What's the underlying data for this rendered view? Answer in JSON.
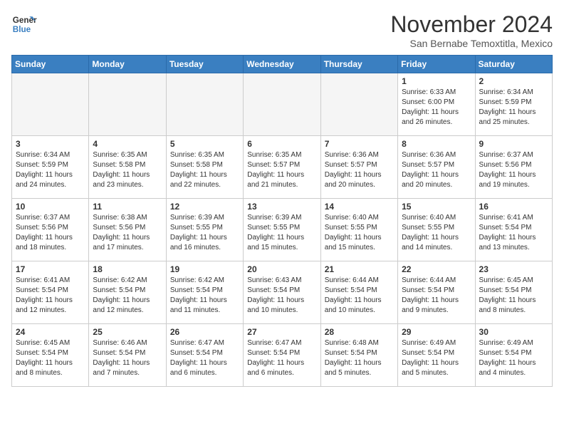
{
  "header": {
    "logo_line1": "General",
    "logo_line2": "Blue",
    "month": "November 2024",
    "location": "San Bernabe Temoxtitla, Mexico"
  },
  "days_of_week": [
    "Sunday",
    "Monday",
    "Tuesday",
    "Wednesday",
    "Thursday",
    "Friday",
    "Saturday"
  ],
  "weeks": [
    [
      {
        "day": "",
        "empty": true
      },
      {
        "day": "",
        "empty": true
      },
      {
        "day": "",
        "empty": true
      },
      {
        "day": "",
        "empty": true
      },
      {
        "day": "",
        "empty": true
      },
      {
        "day": "1",
        "sunrise": "Sunrise: 6:33 AM",
        "sunset": "Sunset: 6:00 PM",
        "daylight": "Daylight: 11 hours and 26 minutes."
      },
      {
        "day": "2",
        "sunrise": "Sunrise: 6:34 AM",
        "sunset": "Sunset: 5:59 PM",
        "daylight": "Daylight: 11 hours and 25 minutes."
      }
    ],
    [
      {
        "day": "3",
        "sunrise": "Sunrise: 6:34 AM",
        "sunset": "Sunset: 5:59 PM",
        "daylight": "Daylight: 11 hours and 24 minutes."
      },
      {
        "day": "4",
        "sunrise": "Sunrise: 6:35 AM",
        "sunset": "Sunset: 5:58 PM",
        "daylight": "Daylight: 11 hours and 23 minutes."
      },
      {
        "day": "5",
        "sunrise": "Sunrise: 6:35 AM",
        "sunset": "Sunset: 5:58 PM",
        "daylight": "Daylight: 11 hours and 22 minutes."
      },
      {
        "day": "6",
        "sunrise": "Sunrise: 6:35 AM",
        "sunset": "Sunset: 5:57 PM",
        "daylight": "Daylight: 11 hours and 21 minutes."
      },
      {
        "day": "7",
        "sunrise": "Sunrise: 6:36 AM",
        "sunset": "Sunset: 5:57 PM",
        "daylight": "Daylight: 11 hours and 20 minutes."
      },
      {
        "day": "8",
        "sunrise": "Sunrise: 6:36 AM",
        "sunset": "Sunset: 5:57 PM",
        "daylight": "Daylight: 11 hours and 20 minutes."
      },
      {
        "day": "9",
        "sunrise": "Sunrise: 6:37 AM",
        "sunset": "Sunset: 5:56 PM",
        "daylight": "Daylight: 11 hours and 19 minutes."
      }
    ],
    [
      {
        "day": "10",
        "sunrise": "Sunrise: 6:37 AM",
        "sunset": "Sunset: 5:56 PM",
        "daylight": "Daylight: 11 hours and 18 minutes."
      },
      {
        "day": "11",
        "sunrise": "Sunrise: 6:38 AM",
        "sunset": "Sunset: 5:56 PM",
        "daylight": "Daylight: 11 hours and 17 minutes."
      },
      {
        "day": "12",
        "sunrise": "Sunrise: 6:39 AM",
        "sunset": "Sunset: 5:55 PM",
        "daylight": "Daylight: 11 hours and 16 minutes."
      },
      {
        "day": "13",
        "sunrise": "Sunrise: 6:39 AM",
        "sunset": "Sunset: 5:55 PM",
        "daylight": "Daylight: 11 hours and 15 minutes."
      },
      {
        "day": "14",
        "sunrise": "Sunrise: 6:40 AM",
        "sunset": "Sunset: 5:55 PM",
        "daylight": "Daylight: 11 hours and 15 minutes."
      },
      {
        "day": "15",
        "sunrise": "Sunrise: 6:40 AM",
        "sunset": "Sunset: 5:55 PM",
        "daylight": "Daylight: 11 hours and 14 minutes."
      },
      {
        "day": "16",
        "sunrise": "Sunrise: 6:41 AM",
        "sunset": "Sunset: 5:54 PM",
        "daylight": "Daylight: 11 hours and 13 minutes."
      }
    ],
    [
      {
        "day": "17",
        "sunrise": "Sunrise: 6:41 AM",
        "sunset": "Sunset: 5:54 PM",
        "daylight": "Daylight: 11 hours and 12 minutes."
      },
      {
        "day": "18",
        "sunrise": "Sunrise: 6:42 AM",
        "sunset": "Sunset: 5:54 PM",
        "daylight": "Daylight: 11 hours and 12 minutes."
      },
      {
        "day": "19",
        "sunrise": "Sunrise: 6:42 AM",
        "sunset": "Sunset: 5:54 PM",
        "daylight": "Daylight: 11 hours and 11 minutes."
      },
      {
        "day": "20",
        "sunrise": "Sunrise: 6:43 AM",
        "sunset": "Sunset: 5:54 PM",
        "daylight": "Daylight: 11 hours and 10 minutes."
      },
      {
        "day": "21",
        "sunrise": "Sunrise: 6:44 AM",
        "sunset": "Sunset: 5:54 PM",
        "daylight": "Daylight: 11 hours and 10 minutes."
      },
      {
        "day": "22",
        "sunrise": "Sunrise: 6:44 AM",
        "sunset": "Sunset: 5:54 PM",
        "daylight": "Daylight: 11 hours and 9 minutes."
      },
      {
        "day": "23",
        "sunrise": "Sunrise: 6:45 AM",
        "sunset": "Sunset: 5:54 PM",
        "daylight": "Daylight: 11 hours and 8 minutes."
      }
    ],
    [
      {
        "day": "24",
        "sunrise": "Sunrise: 6:45 AM",
        "sunset": "Sunset: 5:54 PM",
        "daylight": "Daylight: 11 hours and 8 minutes."
      },
      {
        "day": "25",
        "sunrise": "Sunrise: 6:46 AM",
        "sunset": "Sunset: 5:54 PM",
        "daylight": "Daylight: 11 hours and 7 minutes."
      },
      {
        "day": "26",
        "sunrise": "Sunrise: 6:47 AM",
        "sunset": "Sunset: 5:54 PM",
        "daylight": "Daylight: 11 hours and 6 minutes."
      },
      {
        "day": "27",
        "sunrise": "Sunrise: 6:47 AM",
        "sunset": "Sunset: 5:54 PM",
        "daylight": "Daylight: 11 hours and 6 minutes."
      },
      {
        "day": "28",
        "sunrise": "Sunrise: 6:48 AM",
        "sunset": "Sunset: 5:54 PM",
        "daylight": "Daylight: 11 hours and 5 minutes."
      },
      {
        "day": "29",
        "sunrise": "Sunrise: 6:49 AM",
        "sunset": "Sunset: 5:54 PM",
        "daylight": "Daylight: 11 hours and 5 minutes."
      },
      {
        "day": "30",
        "sunrise": "Sunrise: 6:49 AM",
        "sunset": "Sunset: 5:54 PM",
        "daylight": "Daylight: 11 hours and 4 minutes."
      }
    ]
  ]
}
